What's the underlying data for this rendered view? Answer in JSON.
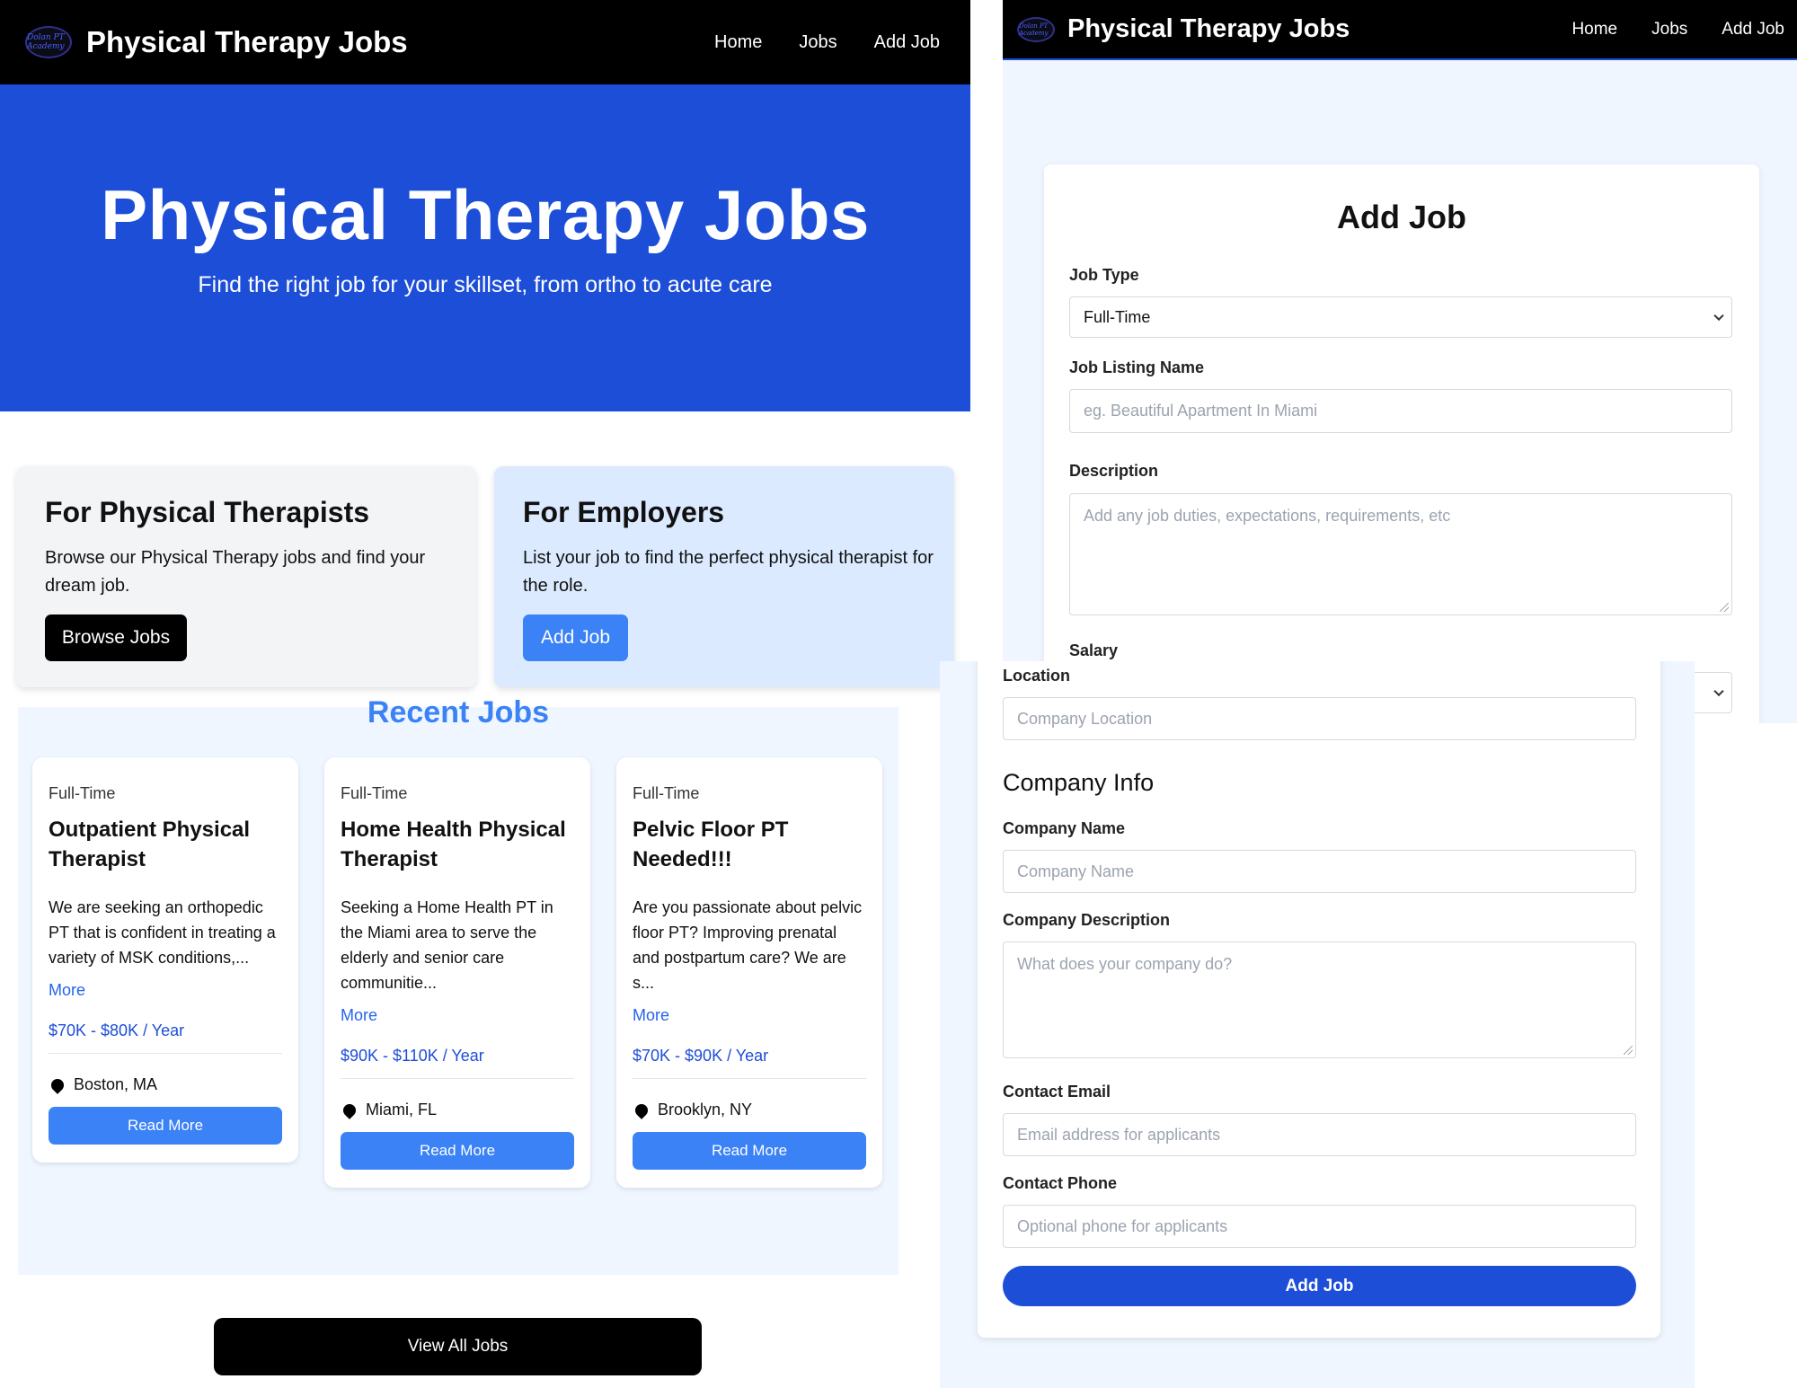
{
  "home": {
    "nav": {
      "logo_text": "Dolan PT Academy",
      "brand": "Physical Therapy Jobs",
      "links": [
        "Home",
        "Jobs",
        "Add Job"
      ]
    },
    "hero": {
      "title": "Physical Therapy Jobs",
      "subtitle": "Find the right job for your skillset, from ortho to acute care"
    },
    "cards": [
      {
        "title": "For Physical Therapists",
        "text": "Browse our Physical Therapy jobs and find your dream job.",
        "button": "Browse Jobs"
      },
      {
        "title": "For Employers",
        "text": "List your job to find the perfect physical therapist for the role.",
        "button": "Add Job"
      }
    ],
    "recent_title": "Recent Jobs",
    "jobs": [
      {
        "type": "Full-Time",
        "title": "Outpatient Physical Therapist",
        "description": "We are seeking an orthopedic PT that is confident in treating a variety of MSK conditions,...",
        "more": "More",
        "salary": "$70K - $80K / Year",
        "location": "Boston, MA",
        "button": "Read More"
      },
      {
        "type": "Full-Time",
        "title": "Home Health Physical Therapist",
        "description": "Seeking a Home Health PT in the Miami area to serve the elderly and senior care communitie...",
        "more": "More",
        "salary": "$90K - $110K / Year",
        "location": "Miami, FL",
        "button": "Read More"
      },
      {
        "type": "Full-Time",
        "title": "Pelvic Floor PT Needed!!!",
        "description": "Are you passionate about pelvic floor PT? Improving prenatal and postpartum care? We are s...",
        "more": "More",
        "salary": "$70K - $90K / Year",
        "location": "Brooklyn, NY",
        "button": "Read More"
      }
    ],
    "view_all": "View All Jobs"
  },
  "add_job": {
    "nav": {
      "logo_text": "Dolan PT Academy",
      "brand": "Physical Therapy Jobs",
      "links": [
        "Home",
        "Jobs",
        "Add Job"
      ]
    },
    "title": "Add Job",
    "job_type": {
      "label": "Job Type",
      "value": "Full-Time"
    },
    "listing_name": {
      "label": "Job Listing Name",
      "placeholder": "eg. Beautiful Apartment In Miami"
    },
    "description": {
      "label": "Description",
      "placeholder": "Add any job duties, expectations, requirements, etc"
    },
    "salary": {
      "label": "Salary"
    },
    "location": {
      "label": "Location",
      "placeholder": "Company Location"
    },
    "company_section": "Company Info",
    "company_name": {
      "label": "Company Name",
      "placeholder": "Company Name"
    },
    "company_description": {
      "label": "Company Description",
      "placeholder": "What does your company do?"
    },
    "contact_email": {
      "label": "Contact Email",
      "placeholder": "Email address for applicants"
    },
    "contact_phone": {
      "label": "Contact Phone",
      "placeholder": "Optional phone for applicants"
    },
    "submit": "Add Job"
  },
  "colors": {
    "primary_blue": "#1d4ed8",
    "accent_blue": "#3b82f6",
    "light_blue_bg": "#eff6ff",
    "employer_card_bg": "#dbeafe",
    "therapist_card_bg": "#f3f4f6",
    "nav_bg": "#000000"
  },
  "icons": {
    "location": "map-pin-icon",
    "select": "chevron-down-icon"
  }
}
